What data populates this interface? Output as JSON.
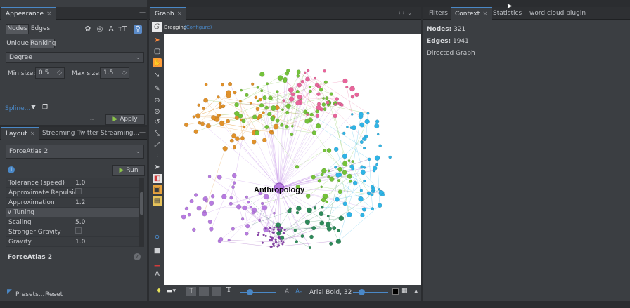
{
  "appearance": {
    "tab_label": "Appearance",
    "nodes_tab": "Nodes",
    "edges_tab": "Edges",
    "unique_tab": "Unique",
    "ranking_tab": "Ranking",
    "attribute": "Degree",
    "min_label": "Min size:",
    "min_value": "0.5",
    "max_label": "Max size:",
    "max_value": "1.5",
    "spline_label": "Spline...",
    "apply_label": "Apply"
  },
  "layout": {
    "tabs": [
      "Layout",
      "Streaming",
      "Twitter Streaming..."
    ],
    "algorithm": "ForceAtlas 2",
    "run_label": "Run",
    "properties": [
      {
        "key": "Tolerance (speed)",
        "value": "1.0"
      },
      {
        "key": "Approximate Repulsion",
        "value": ""
      },
      {
        "key": "Approximation",
        "value": "1.2"
      },
      {
        "key": "Tuning",
        "value": ""
      },
      {
        "key": "Scaling",
        "value": "5.0"
      },
      {
        "key": "Stronger Gravity",
        "value": ""
      },
      {
        "key": "Gravity",
        "value": "1.0"
      }
    ],
    "description_title": "ForceAtlas 2",
    "presets_label": "Presets...",
    "reset_label": "Reset"
  },
  "graph": {
    "tab_label": "Graph",
    "mode_label": "Dragging",
    "configure_label": "(Configure)",
    "center_label": "Anthropology",
    "font_label": "Arial Bold, 32"
  },
  "context": {
    "tabs": [
      "Filters",
      "Context",
      "Statistics",
      "word cloud plugin"
    ],
    "nodes_label": "Nodes:",
    "nodes_value": "321",
    "edges_label": "Edges:",
    "edges_value": "1941",
    "graph_type": "Directed Graph"
  },
  "colors": {
    "accent": "#4a88c7",
    "cluster_purple": "#b77be0",
    "cluster_orange": "#e0912a",
    "cluster_green": "#74c23a",
    "cluster_blue": "#2fb4e6",
    "cluster_pink": "#e8649a",
    "cluster_darkgreen": "#2e8a5a"
  }
}
